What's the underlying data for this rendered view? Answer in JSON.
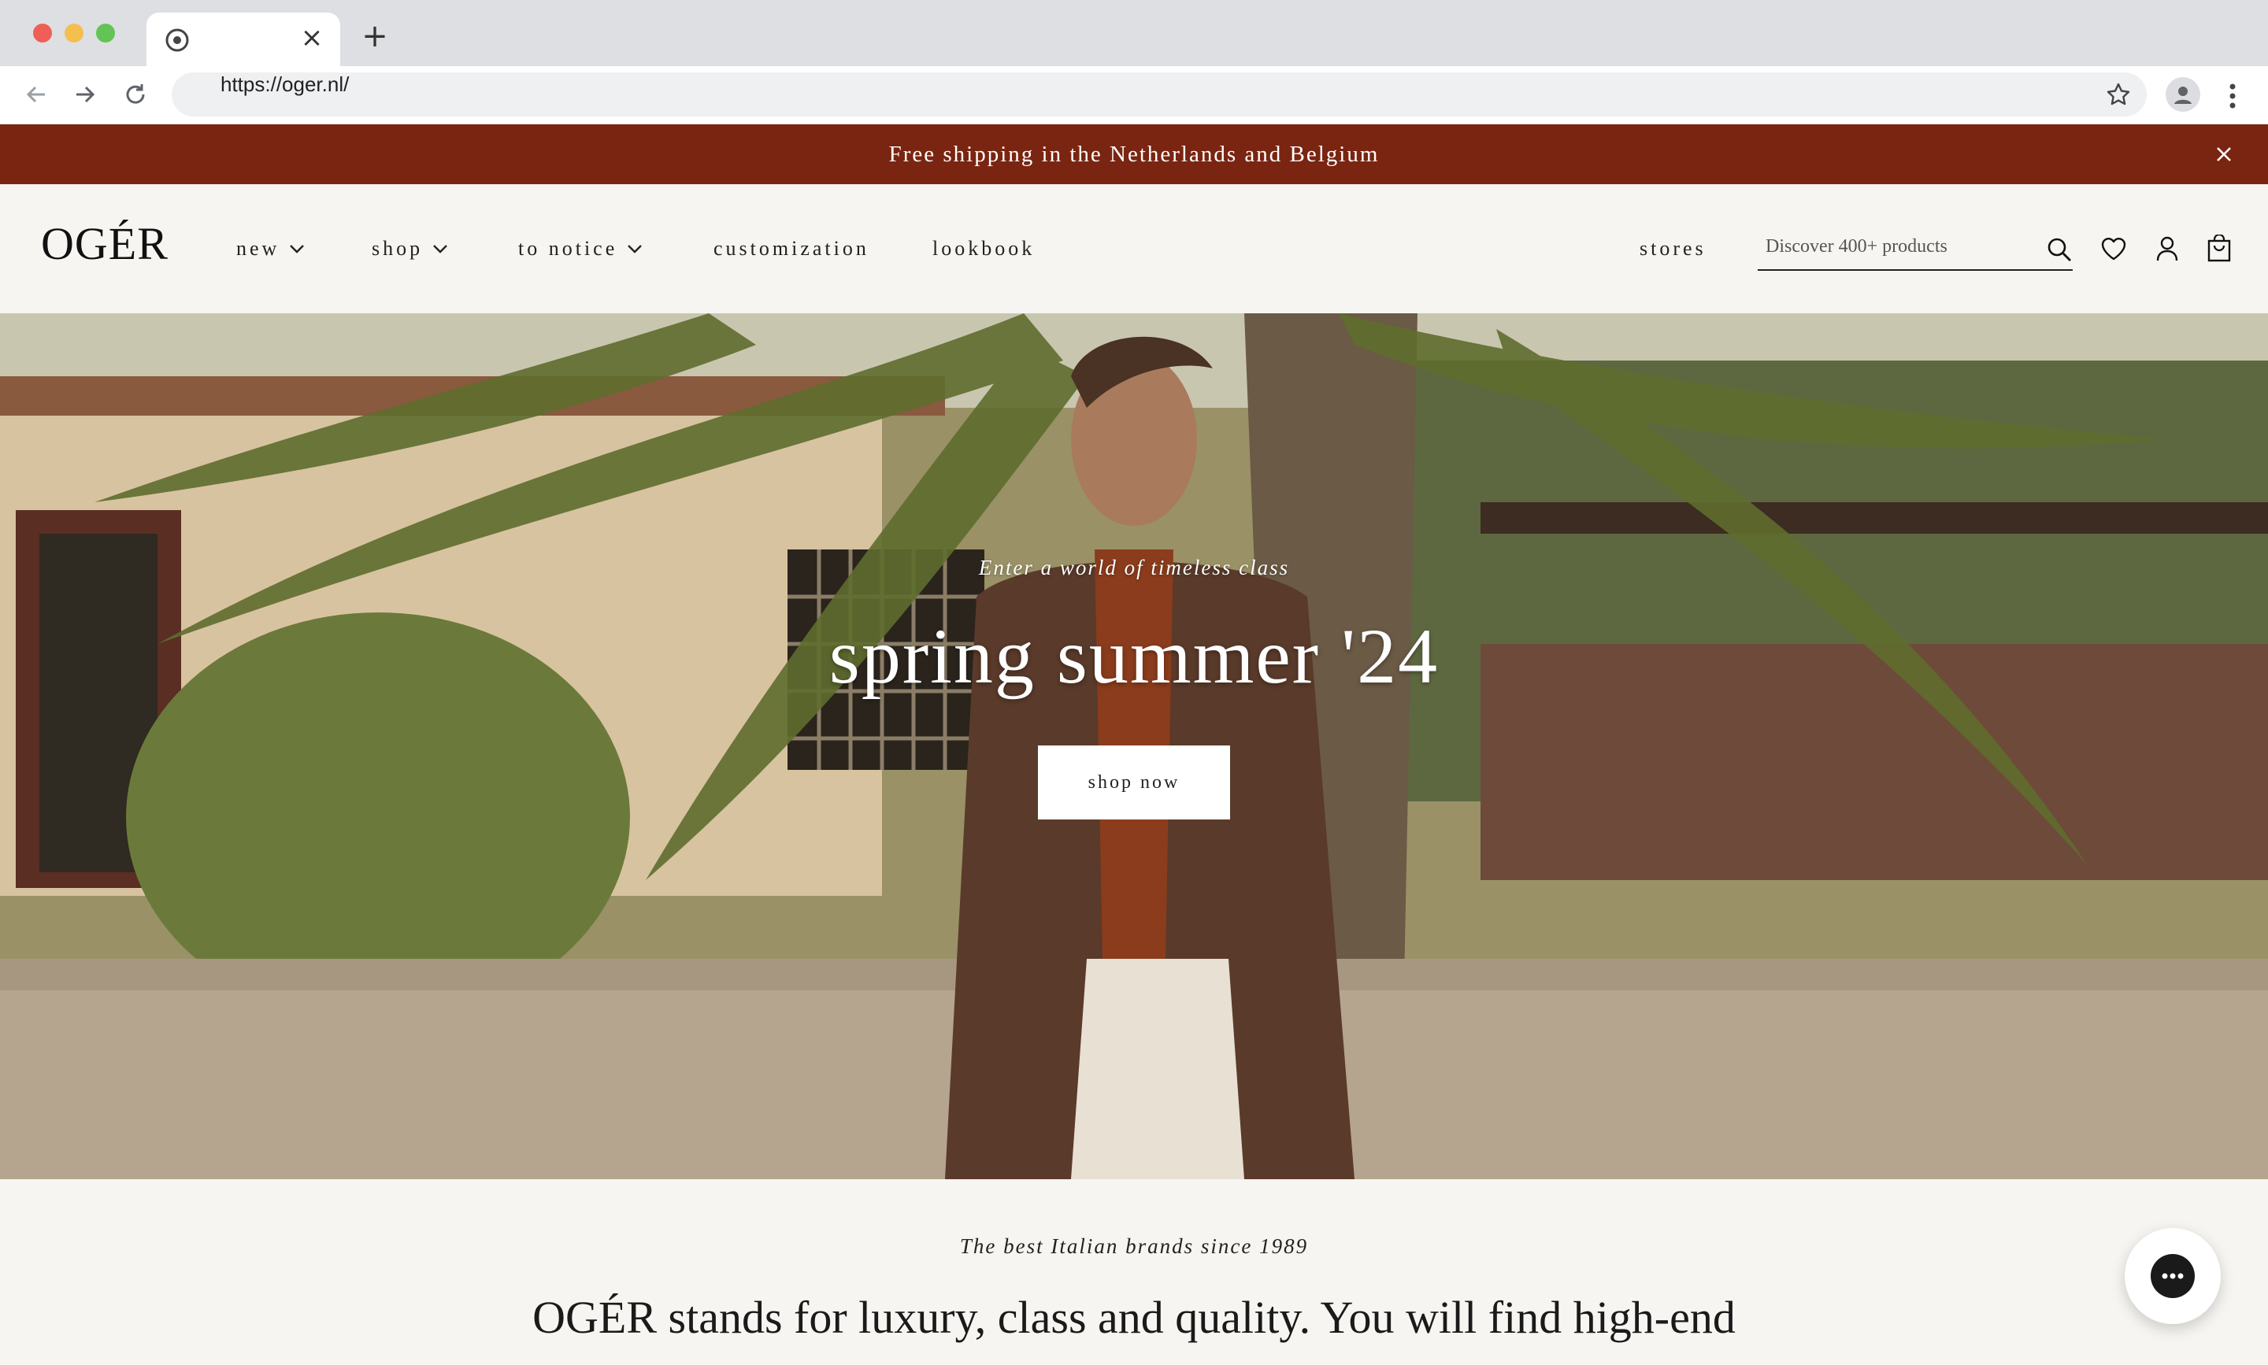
{
  "browser": {
    "url": "https://oger.nl/",
    "icons": {
      "back": "arrow-left-icon",
      "forward": "arrow-right-icon",
      "reload": "reload-icon",
      "bookmark": "star-icon",
      "profile": "profile-icon",
      "menu": "kebab-icon"
    }
  },
  "announcement": {
    "text": "Free shipping in the Netherlands and Belgium",
    "background": "#7a2511"
  },
  "header": {
    "logo": "OGÉR",
    "menu": [
      {
        "label": "new",
        "has_dropdown": true
      },
      {
        "label": "shop",
        "has_dropdown": true
      },
      {
        "label": "to notice",
        "has_dropdown": true
      },
      {
        "label": "customization",
        "has_dropdown": false
      },
      {
        "label": "lookbook",
        "has_dropdown": false
      }
    ],
    "stores_label": "stores",
    "search_placeholder": "Discover 400+ products",
    "icons": [
      "search-icon",
      "heart-icon",
      "account-icon",
      "cart-icon"
    ]
  },
  "hero": {
    "subtitle": "Enter a world of timeless class",
    "title": "spring summer '24",
    "cta_label": "shop now"
  },
  "intro": {
    "subtitle": "The best Italian brands since 1989",
    "body": "OGÉR stands for luxury, class and quality. You will find high-end"
  }
}
